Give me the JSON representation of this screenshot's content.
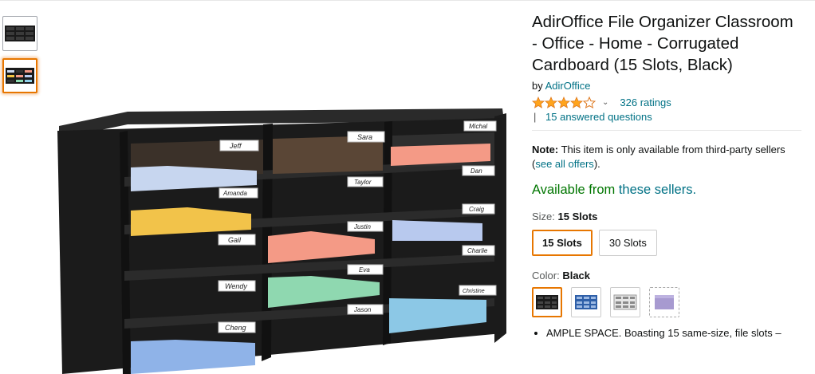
{
  "product": {
    "title": "AdirOffice File Organizer Classroom - Office - Home - Corrugated Cardboard (15 Slots, Black)",
    "by_prefix": "by",
    "brand": "AdirOffice",
    "rating_stars": 4.5,
    "ratings_count": "326 ratings",
    "qa_separator": "|",
    "answered_questions": "15 answered questions",
    "note_label": "Note:",
    "note_text": "This item is only available from third-party sellers (",
    "note_link": "see all offers",
    "note_end": ").",
    "availability_prefix": "Available from",
    "availability_link": "these sellers.",
    "size_label": "Size:",
    "size_value": "15 Slots",
    "size_options": [
      "15 Slots",
      "30 Slots"
    ],
    "color_label": "Color:",
    "color_value": "Black",
    "bullet_1": "AMPLE SPACE. Boasting 15 same-size, file slots –"
  },
  "labels": {
    "names": [
      "Jeff",
      "Sara",
      "Michal",
      "Amanda",
      "Taylor",
      "Dan",
      "Gail",
      "Justin",
      "Craig",
      "Wendy",
      "Eva",
      "Charlie",
      "Cheng",
      "Jason",
      "Christine"
    ]
  },
  "colors": {
    "accent_orange": "#e77600",
    "link": "#007185",
    "available_green": "#007600",
    "star": "#ffa41c"
  }
}
